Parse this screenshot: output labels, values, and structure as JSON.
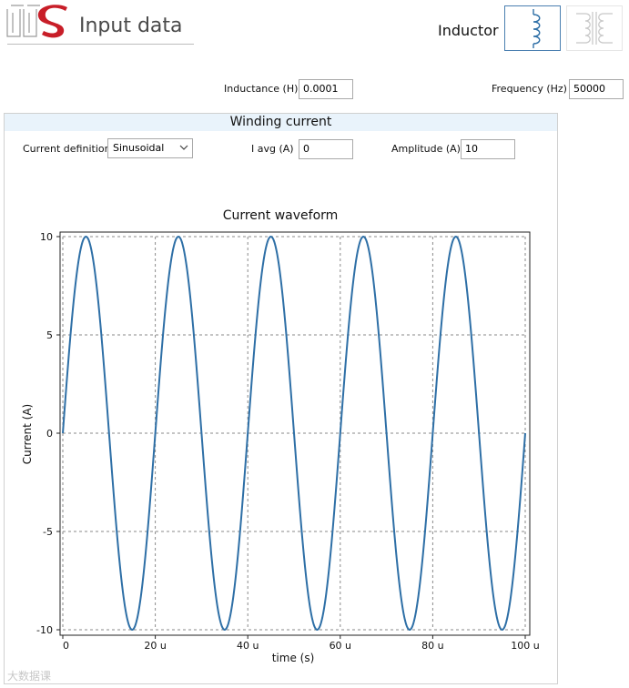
{
  "header": {
    "title": "Input data",
    "component_type": "Inductor",
    "icons": [
      "inductor-icon",
      "transformer-icon"
    ]
  },
  "inputs": {
    "inductance_label": "Inductance (H)",
    "inductance_value": "0.0001",
    "frequency_label": "Frequency (Hz)",
    "frequency_value": "50000"
  },
  "winding": {
    "section_title": "Winding current",
    "current_definition_label": "Current definition",
    "current_definition_value": "Sinusoidal",
    "iavg_label": "I avg (A)",
    "iavg_value": "0",
    "amplitude_label": "Amplitude (A)",
    "amplitude_value": "10"
  },
  "watermark": "大数据课",
  "colors": {
    "series": "#2e6fa6",
    "panel_header": "#e9f3fb",
    "selected_border": "#4a7fb0"
  },
  "chart_data": {
    "type": "line",
    "title": "Current waveform",
    "xlabel": "time (s)",
    "ylabel": "Current (A)",
    "xlim": [
      0,
      100
    ],
    "ylim": [
      -10,
      10
    ],
    "xticks": [
      0,
      20,
      40,
      60,
      80,
      100
    ],
    "xtick_labels": [
      "0",
      "20 u",
      "40 u",
      "60 u",
      "80 u",
      "100 u"
    ],
    "yticks": [
      10,
      5,
      0,
      -5,
      -10
    ],
    "ytick_labels": [
      "10",
      "5",
      "0",
      "-5",
      "-10"
    ],
    "grid": true,
    "series": [
      {
        "function": "sine",
        "amplitude": 10,
        "offset": 0,
        "period": 20
      }
    ]
  }
}
